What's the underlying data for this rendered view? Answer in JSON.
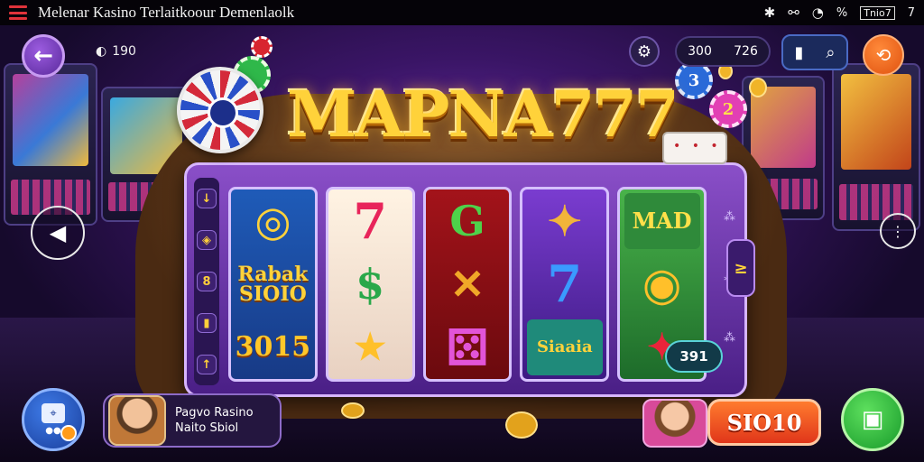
{
  "status_bar": {
    "title": "Melenar Kasino Terlaitkoour Demenlaolk",
    "icons": [
      "bluetooth-icon",
      "link-icon",
      "wifi-icon"
    ],
    "percent": "%",
    "battery": "Tnio7",
    "signal": "7"
  },
  "top_left": {
    "back_icon": "arrow-left-icon",
    "coins": "190"
  },
  "hud": {
    "stat_a": "300",
    "stat_b": "726"
  },
  "logo": {
    "title": "MAPNA777"
  },
  "chips": {
    "chip_a": "3",
    "chip_b": "2"
  },
  "reels": [
    {
      "symbols": [
        "◎",
        "Rabak SIOIO",
        "3015"
      ]
    },
    {
      "symbols": [
        "7",
        "$",
        "★"
      ]
    },
    {
      "symbols": [
        "G",
        "✕",
        "⚄"
      ]
    },
    {
      "symbols": [
        "✦",
        "7",
        "Siaaia"
      ]
    },
    {
      "symbols": [
        "MAD",
        "◉",
        "✦"
      ]
    }
  ],
  "side_buttons": [
    "↓",
    "◈",
    "8",
    "▮",
    "↑"
  ],
  "side_right_label": "≥",
  "win_value": "391",
  "profile": {
    "line1": "Pagvo Rasino",
    "line2": "Naito Sbiol"
  },
  "spin_button": "SIO10",
  "colors": {
    "accent": "#ffd23a",
    "brand_purple": "#6b2fa8",
    "spin": "#ff7b2e",
    "shop": "#5ee05e"
  }
}
